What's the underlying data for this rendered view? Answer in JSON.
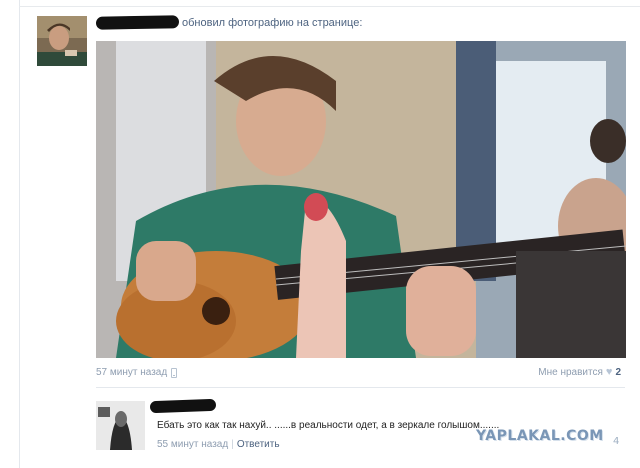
{
  "post": {
    "action_text": "обновил фотографию на странице:",
    "time": "57 минут назад",
    "like_label": "Мне нравится",
    "like_count": "2"
  },
  "comment": {
    "text": "Ебать это как так нахуй.. ......в реальности одет, а в зеркале голышом.......",
    "time": "55 минут назад",
    "separator": "|",
    "reply_label": "Ответить"
  },
  "watermark": {
    "text": "YAPLAKAL.COM",
    "suffix": "4"
  },
  "icons": {
    "phone": "mobile-phone-icon",
    "heart": "heart-icon"
  },
  "colors": {
    "link": "#4d6380",
    "muted": "#8e9db0",
    "divider": "#e4e8ed"
  }
}
